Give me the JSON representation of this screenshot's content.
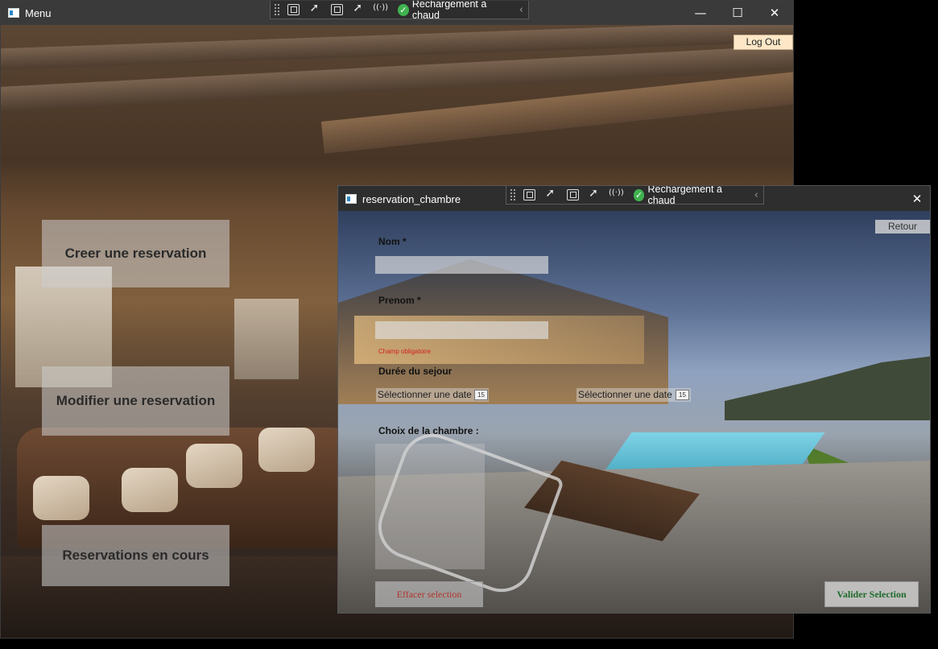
{
  "menu_window": {
    "title": "Menu",
    "controls": {
      "minimize": "—",
      "maximize": "☐",
      "close": "✕"
    },
    "hot_reload_label": "Rechargement à chaud",
    "logout_label": "Log Out",
    "buttons": [
      {
        "label": "Creer une reservation"
      },
      {
        "label": "Modifier une reservation"
      },
      {
        "label": "Reservations en cours"
      }
    ]
  },
  "reservation_window": {
    "title": "reservation_chambre",
    "controls": {
      "close": "✕"
    },
    "hot_reload_label": "Rechargement à chaud",
    "retour_label": "Retour",
    "form": {
      "nom_label": "Nom *",
      "prenom_label": "Prenom *",
      "error_text": "Champ obligatoire",
      "duree_label": "Durée du sejour",
      "date_start_placeholder": "Sélectionner une date",
      "date_end_placeholder": "Sélectionner une date",
      "calendar_day": "15",
      "room_choice_label": "Choix de la chambre :"
    },
    "clear_button": "Effacer selection",
    "validate_button": "Valider Selection"
  },
  "colors": {
    "logout_bg": "#fde7c7",
    "clear_text": "#b1342c",
    "validate_text": "#1e6b2a",
    "hot_reload_check": "#3fb24f",
    "error_text": "#d21f1f"
  }
}
